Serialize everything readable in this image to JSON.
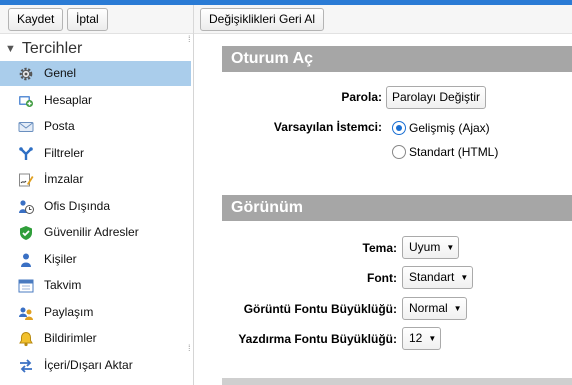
{
  "toolbar": {
    "save_label": "Kaydet",
    "cancel_label": "İptal",
    "revert_label": "Değişiklikleri Geri Al"
  },
  "sidebar": {
    "header": "Tercihler",
    "items": [
      {
        "label": "Genel",
        "icon": "gear-icon",
        "selected": true
      },
      {
        "label": "Hesaplar",
        "icon": "accounts-icon"
      },
      {
        "label": "Posta",
        "icon": "envelope-icon"
      },
      {
        "label": "Filtreler",
        "icon": "filter-icon"
      },
      {
        "label": "İmzalar",
        "icon": "signature-icon"
      },
      {
        "label": "Ofis Dışında",
        "icon": "out-of-office-icon"
      },
      {
        "label": "Güvenilir Adresler",
        "icon": "shield-check-icon"
      },
      {
        "label": "Kişiler",
        "icon": "person-icon"
      },
      {
        "label": "Takvim",
        "icon": "calendar-icon"
      },
      {
        "label": "Paylaşım",
        "icon": "sharing-icon"
      },
      {
        "label": "Bildirimler",
        "icon": "bell-icon"
      },
      {
        "label": "İçeri/Dışarı Aktar",
        "icon": "import-export-icon"
      }
    ]
  },
  "login": {
    "title": "Oturum Aç",
    "password_label": "Parola:",
    "password_button": "Parolayı Değiştir",
    "client_label": "Varsayılan İstemci:",
    "client_options": [
      {
        "label": "Gelişmiş (Ajax)",
        "checked": true
      },
      {
        "label": "Standart (HTML)",
        "checked": false
      }
    ]
  },
  "appearance": {
    "title": "Görünüm",
    "theme_label": "Tema:",
    "theme_value": "Uyum",
    "font_label": "Font:",
    "font_value": "Standart",
    "display_font_size_label": "Görüntü Fontu Büyüklüğü:",
    "display_font_size_value": "Normal",
    "print_font_size_label": "Yazdırma Fontu Büyüklüğü:",
    "print_font_size_value": "12"
  },
  "colors": {
    "accent": "#2a7bd5",
    "selected_row": "#aacdeb",
    "section_header": "#a6a6a6",
    "radio_checked": "#1a6fd3"
  }
}
